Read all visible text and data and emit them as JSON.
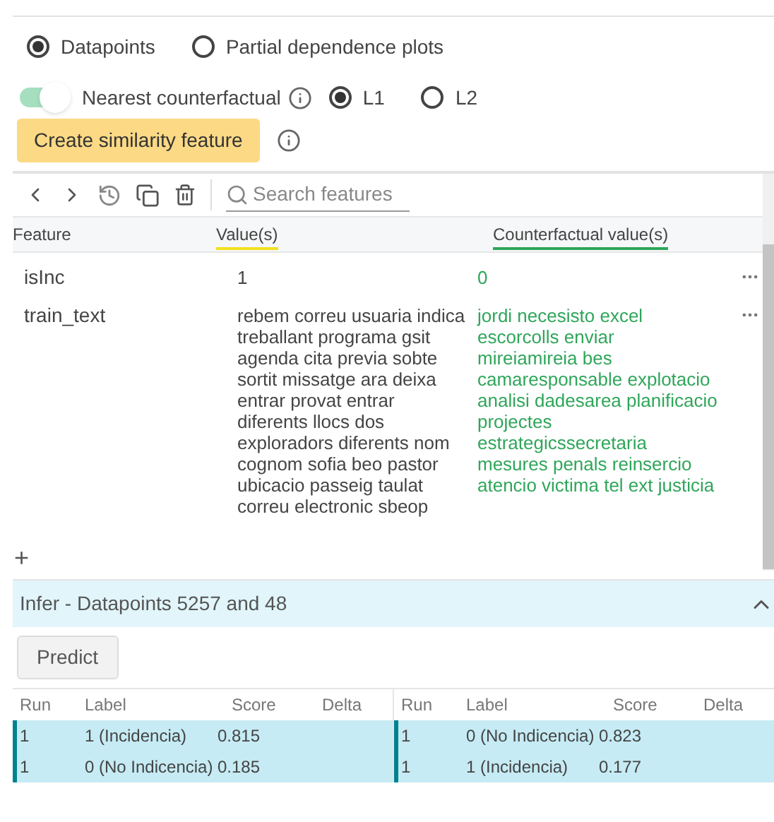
{
  "view_options": [
    {
      "label": "Datapoints",
      "selected": true
    },
    {
      "label": "Partial dependence plots",
      "selected": false
    }
  ],
  "counterfactual": {
    "label": "Nearest counterfactual",
    "on": true,
    "distance": [
      {
        "label": "L1",
        "selected": true
      },
      {
        "label": "L2",
        "selected": false
      }
    ]
  },
  "similarity_button": "Create similarity feature",
  "search": {
    "placeholder": "Search features"
  },
  "feature_table": {
    "columns": [
      {
        "label": "Feature"
      },
      {
        "label": "Value(s)",
        "color": "#f2e01f"
      },
      {
        "label": "Counterfactual value(s)",
        "color": "#2fa65a"
      }
    ],
    "rows": [
      {
        "feature": "isInc",
        "value": "1",
        "counterfactual": "0"
      },
      {
        "feature": "train_text",
        "value": "rebem correu usuaria indica treballant programa gsit agenda cita previa sobte sortit missatge ara deixa entrar provat entrar diferents llocs dos exploradors diferents nom cognom sofia beo pastor ubicacio passeig taulat correu electronic sbeop",
        "counterfactual": "jordi necesisto excel escorcolls enviar mireiamireia bes camaresponsable explotacio analisi dadesarea planificacio projectes estrategicssecretaria mesures penals reinsercio atencio victima tel ext justicia"
      }
    ]
  },
  "add_symbol": "+",
  "infer": {
    "title": "Infer - Datapoints 5257 and 48",
    "expanded": true,
    "predict_button": "Predict",
    "results": [
      {
        "columns": [
          "Run",
          "Label",
          "Score",
          "Delta"
        ],
        "rows": [
          [
            "1",
            "1 (Incidencia)",
            "0.815"
          ],
          [
            "1",
            "0 (No Indicencia)",
            "0.185"
          ]
        ]
      },
      {
        "columns": [
          "Run",
          "Label",
          "Score",
          "Delta"
        ],
        "rows": [
          [
            "1",
            "0 (No Indicencia)",
            "0.823"
          ],
          [
            "1",
            "1 (Incidencia)",
            "0.177"
          ]
        ]
      }
    ]
  }
}
